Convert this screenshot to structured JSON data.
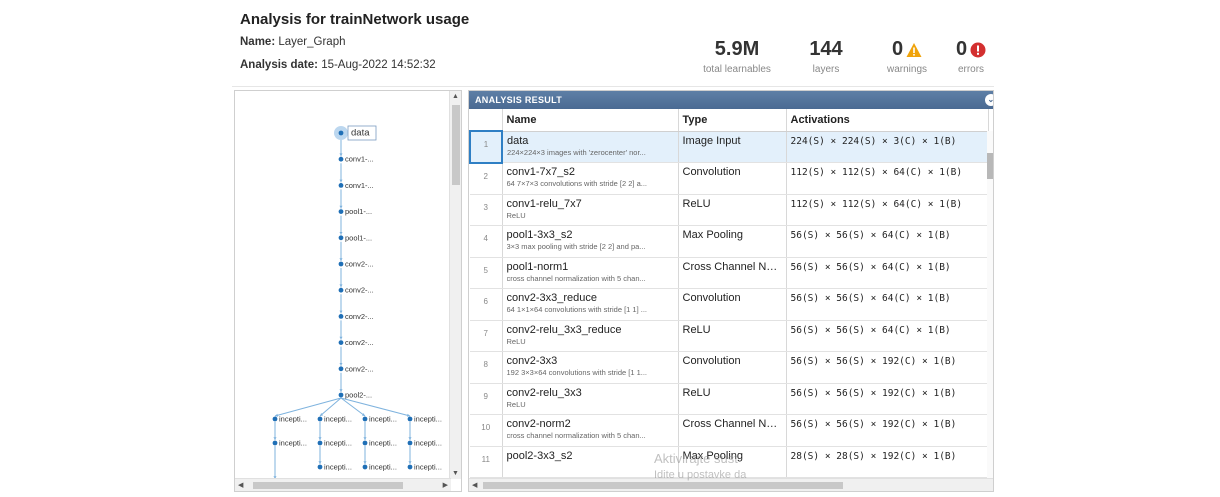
{
  "header": {
    "title": "Analysis for trainNetwork usage",
    "name_label": "Name:",
    "name_value": "Layer_Graph",
    "date_label": "Analysis date:",
    "date_value": "15-Aug-2022 14:52:32"
  },
  "stats": {
    "learnables_value": "5.9M",
    "learnables_label": "total learnables",
    "layers_value": "144",
    "layers_label": "layers",
    "warnings_value": "0",
    "warnings_label": "warnings",
    "errors_value": "0",
    "errors_label": "errors",
    "warning_color": "#f0a30a",
    "error_color": "#d32f2f"
  },
  "graph": {
    "icons": [
      "scroll-up-icon",
      "scroll-down-icon",
      "scroll-left-icon",
      "scroll-right-icon"
    ],
    "chain": [
      "data",
      "conv1-...",
      "conv1-...",
      "pool1-...",
      "pool1-...",
      "conv2-...",
      "conv2-...",
      "conv2-...",
      "conv2-...",
      "conv2-...",
      "pool2-..."
    ],
    "branch_row1": [
      "incepti...",
      "incepti...",
      "incepti...",
      "incepti..."
    ],
    "branch_row2": [
      "incepti...",
      "incepti...",
      "incepti...",
      "incepti..."
    ],
    "branch_row3": [
      "incepti...",
      "incepti...",
      "incepti..."
    ],
    "node_color": "#1f6fb6",
    "edge_color": "#7fb3de"
  },
  "result": {
    "header": "ANALYSIS RESULT",
    "columns": [
      "Name",
      "Type",
      "Activations"
    ],
    "rows": [
      {
        "idx": "1",
        "name": "data",
        "desc": "224×224×3 images with 'zerocenter' nor...",
        "type": "Image Input",
        "act": "224(S) × 224(S) × 3(C) × 1(B)"
      },
      {
        "idx": "2",
        "name": "conv1-7x7_s2",
        "desc": "64 7×7×3 convolutions with stride [2 2] a...",
        "type": "Convolution",
        "act": "112(S) × 112(S) × 64(C) × 1(B)"
      },
      {
        "idx": "3",
        "name": "conv1-relu_7x7",
        "desc": "ReLU",
        "type": "ReLU",
        "act": "112(S) × 112(S) × 64(C) × 1(B)"
      },
      {
        "idx": "4",
        "name": "pool1-3x3_s2",
        "desc": "3×3 max pooling with stride [2 2] and pa...",
        "type": "Max Pooling",
        "act": "56(S) × 56(S) × 64(C) × 1(B)"
      },
      {
        "idx": "5",
        "name": "pool1-norm1",
        "desc": "cross channel normalization with 5 chan...",
        "type": "Cross Channel Nor...",
        "act": "56(S) × 56(S) × 64(C) × 1(B)"
      },
      {
        "idx": "6",
        "name": "conv2-3x3_reduce",
        "desc": "64 1×1×64 convolutions with stride [1 1] ...",
        "type": "Convolution",
        "act": "56(S) × 56(S) × 64(C) × 1(B)"
      },
      {
        "idx": "7",
        "name": "conv2-relu_3x3_reduce",
        "desc": "ReLU",
        "type": "ReLU",
        "act": "56(S) × 56(S) × 64(C) × 1(B)"
      },
      {
        "idx": "8",
        "name": "conv2-3x3",
        "desc": "192 3×3×64 convolutions with stride [1 1...",
        "type": "Convolution",
        "act": "56(S) × 56(S) × 192(C) × 1(B)"
      },
      {
        "idx": "9",
        "name": "conv2-relu_3x3",
        "desc": "ReLU",
        "type": "ReLU",
        "act": "56(S) × 56(S) × 192(C) × 1(B)"
      },
      {
        "idx": "10",
        "name": "conv2-norm2",
        "desc": "cross channel normalization with 5 chan...",
        "type": "Cross Channel Nor...",
        "act": "56(S) × 56(S) × 192(C) × 1(B)"
      },
      {
        "idx": "11",
        "name": "pool2-3x3_s2",
        "desc": "",
        "type": "Max Pooling",
        "act": "28(S) × 28(S) × 192(C) × 1(B)"
      }
    ],
    "selected_row": 1,
    "header_color": "#4f6f97",
    "select_color": "#e3f0fb"
  },
  "watermark": {
    "line1": "Aktivirajte sust",
    "line2": "Idite u postavke da"
  }
}
